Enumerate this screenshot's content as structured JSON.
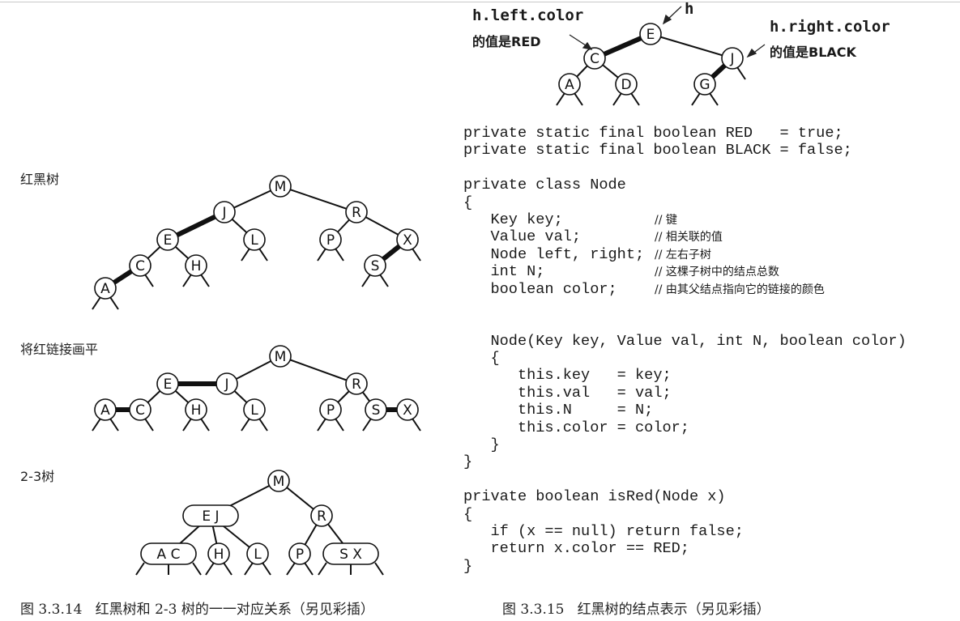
{
  "left_figure": {
    "trees": [
      {
        "label": "红黑树",
        "nodes": [
          "M",
          "J",
          "R",
          "E",
          "L",
          "P",
          "X",
          "C",
          "H",
          "S",
          "A"
        ],
        "edges": [
          [
            "M",
            "J"
          ],
          [
            "M",
            "R"
          ],
          [
            "J",
            "E"
          ],
          [
            "J",
            "L"
          ],
          [
            "E",
            "C"
          ],
          [
            "E",
            "H"
          ],
          [
            "C",
            "A"
          ],
          [
            "R",
            "P"
          ],
          [
            "R",
            "X"
          ],
          [
            "X",
            "S"
          ]
        ],
        "red_links": [
          [
            "J",
            "E"
          ],
          [
            "C",
            "A"
          ],
          [
            "X",
            "S"
          ]
        ]
      },
      {
        "label": "将红链接画平",
        "nodes": [
          "M",
          "E",
          "J",
          "R",
          "A",
          "C",
          "H",
          "L",
          "P",
          "S",
          "X"
        ],
        "edges": [
          [
            "M",
            "J"
          ],
          [
            "M",
            "R"
          ],
          [
            "E",
            "J"
          ],
          [
            "E",
            "C"
          ],
          [
            "E",
            "H"
          ],
          [
            "J",
            "L"
          ],
          [
            "A",
            "C"
          ],
          [
            "R",
            "P"
          ],
          [
            "R",
            "S"
          ],
          [
            "S",
            "X"
          ]
        ],
        "red_links": [
          [
            "E",
            "J"
          ],
          [
            "A",
            "C"
          ],
          [
            "S",
            "X"
          ]
        ]
      },
      {
        "label": "2-3树",
        "nodes": [
          "M",
          "E J",
          "R",
          "A C",
          "H",
          "L",
          "P",
          "S X"
        ],
        "edges": [
          [
            "M",
            "E J"
          ],
          [
            "M",
            "R"
          ],
          [
            "E J",
            "A C"
          ],
          [
            "E J",
            "H"
          ],
          [
            "E J",
            "L"
          ],
          [
            "R",
            "P"
          ],
          [
            "R",
            "S X"
          ]
        ],
        "red_links": []
      }
    ],
    "caption": "图 3.3.14   红黑树和 2-3 树的一一对应关系（另见彩插）"
  },
  "right_figure": {
    "tree": {
      "nodes": [
        "E",
        "C",
        "J",
        "A",
        "D",
        "G"
      ],
      "edges": [
        [
          "E",
          "C"
        ],
        [
          "E",
          "J"
        ],
        [
          "C",
          "A"
        ],
        [
          "C",
          "D"
        ],
        [
          "J",
          "G"
        ]
      ],
      "red_links": [
        [
          "E",
          "C"
        ],
        [
          "J",
          "G"
        ]
      ]
    },
    "annotations": {
      "h": "h",
      "left_code": "h.left.color",
      "left_text": "的值是RED",
      "right_code": "h.right.color",
      "right_text": "的值是BLACK"
    },
    "code_lines": [
      {
        "code": "private static final boolean RED   = true;",
        "comment": ""
      },
      {
        "code": "private static final boolean BLACK = false;",
        "comment": ""
      },
      {
        "code": "",
        "comment": ""
      },
      {
        "code": "private class Node",
        "comment": ""
      },
      {
        "code": "{",
        "comment": ""
      },
      {
        "code": "   Key key;",
        "comment": "// 键"
      },
      {
        "code": "   Value val;",
        "comment": "// 相关联的值"
      },
      {
        "code": "   Node left, right;",
        "comment": "// 左右子树"
      },
      {
        "code": "   int N;",
        "comment": "// 这棵子树中的结点总数"
      },
      {
        "code": "   boolean color;",
        "comment": "// 由其父结点指向它的链接的颜色"
      },
      {
        "code": "",
        "comment": ""
      },
      {
        "code": "",
        "comment": ""
      },
      {
        "code": "   Node(Key key, Value val, int N, boolean color)",
        "comment": ""
      },
      {
        "code": "   {",
        "comment": ""
      },
      {
        "code": "      this.key   = key;",
        "comment": ""
      },
      {
        "code": "      this.val   = val;",
        "comment": ""
      },
      {
        "code": "      this.N     = N;",
        "comment": ""
      },
      {
        "code": "      this.color = color;",
        "comment": ""
      },
      {
        "code": "   }",
        "comment": ""
      },
      {
        "code": "}",
        "comment": ""
      },
      {
        "code": "",
        "comment": ""
      },
      {
        "code": "private boolean isRed(Node x)",
        "comment": ""
      },
      {
        "code": "{",
        "comment": ""
      },
      {
        "code": "   if (x == null) return false;",
        "comment": ""
      },
      {
        "code": "   return x.color == RED;",
        "comment": ""
      },
      {
        "code": "}",
        "comment": ""
      }
    ],
    "caption": "图 3.3.15   红黑树的结点表示（另见彩插）"
  }
}
